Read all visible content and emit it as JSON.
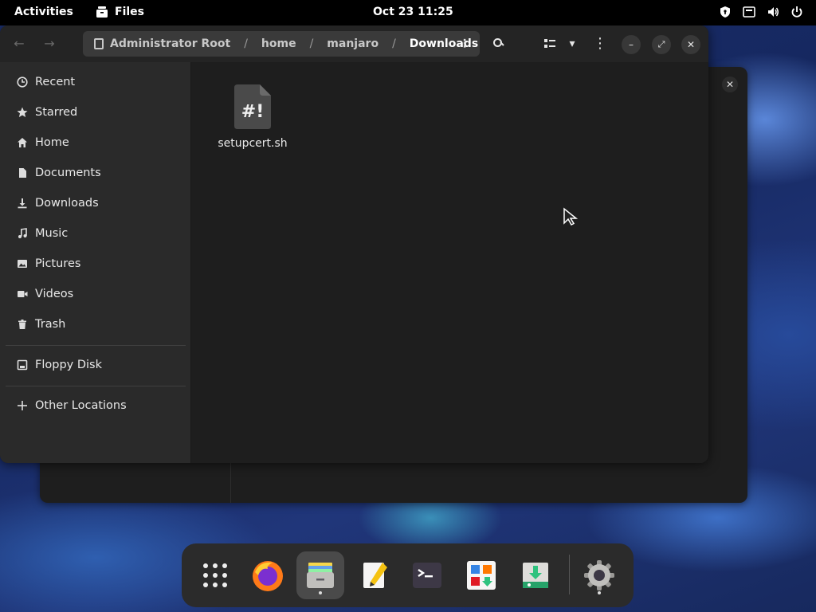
{
  "topbar": {
    "activities": "Activities",
    "app_name": "Files",
    "clock": "Oct 23  11:25",
    "tray_icons": [
      "shield-icon",
      "network-icon",
      "volume-icon",
      "power-icon"
    ]
  },
  "header": {
    "path": [
      "Administrator Root",
      "home",
      "manjaro",
      "Downloads"
    ],
    "icons": [
      "back-icon",
      "forward-icon",
      "search-icon",
      "view-list-icon",
      "view-options-icon",
      "menu-icon",
      "minimize-icon",
      "maximize-icon",
      "close-icon"
    ]
  },
  "sidebar": {
    "items": [
      {
        "label": "Recent",
        "icon": "clock-icon"
      },
      {
        "label": "Starred",
        "icon": "star-icon"
      },
      {
        "label": "Home",
        "icon": "home-icon"
      },
      {
        "label": "Documents",
        "icon": "document-icon"
      },
      {
        "label": "Downloads",
        "icon": "download-icon"
      },
      {
        "label": "Music",
        "icon": "music-icon"
      },
      {
        "label": "Pictures",
        "icon": "picture-icon"
      },
      {
        "label": "Videos",
        "icon": "video-icon"
      },
      {
        "label": "Trash",
        "icon": "trash-icon"
      }
    ],
    "devices": [
      {
        "label": "Floppy Disk",
        "icon": "floppy-icon"
      }
    ],
    "other": {
      "label": "Other Locations",
      "icon": "plus-icon"
    }
  },
  "files": [
    {
      "name": "setupcert.sh",
      "icon": "script-file-icon",
      "glyph": "#!"
    }
  ],
  "dock": {
    "items": [
      "app-grid-icon",
      "firefox-icon",
      "files-icon",
      "text-editor-icon",
      "terminal-icon",
      "software-icon",
      "installer-icon",
      "settings-icon"
    ]
  },
  "colors": {
    "panel": "#000000",
    "window": "#1e1e1e",
    "sidebar": "#2a2a2a",
    "pathbar": "#3a3a3a"
  }
}
